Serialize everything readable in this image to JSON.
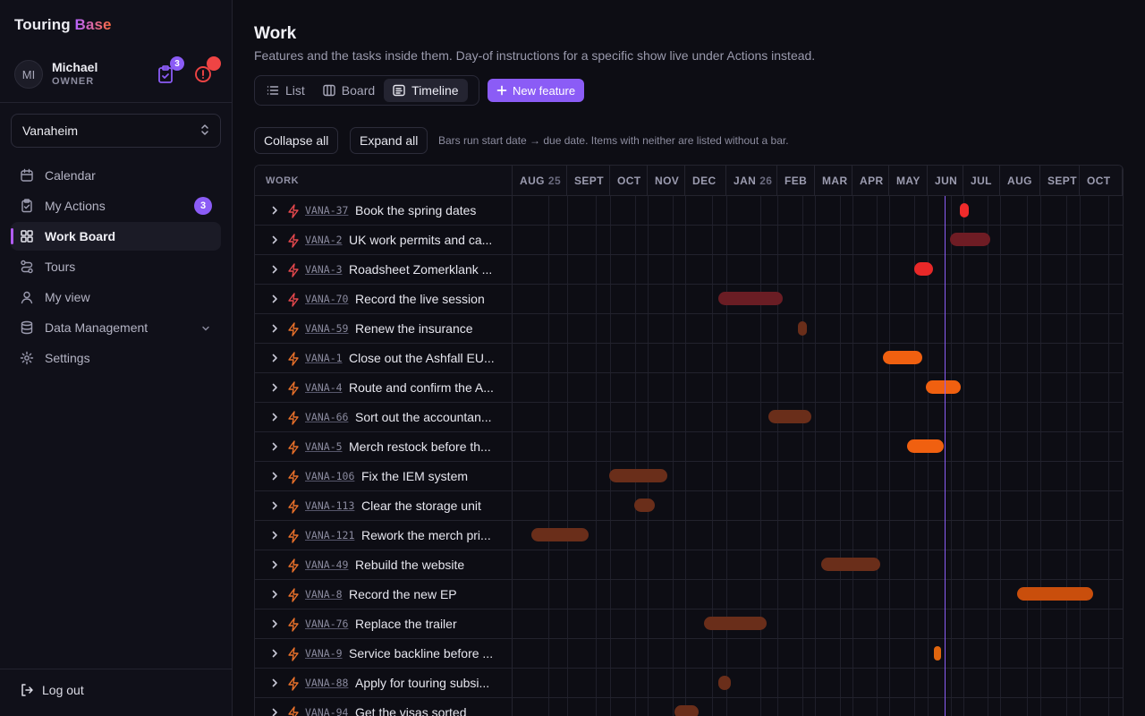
{
  "app": {
    "brand_part1": "Touring",
    "brand_part2": "Base"
  },
  "user": {
    "initials": "MI",
    "name": "Michael",
    "role": "OWNER",
    "tasks_badge": "3"
  },
  "org_select": {
    "value": "Vanaheim"
  },
  "nav": {
    "items": [
      {
        "label": "Calendar",
        "icon": "calendar-icon"
      },
      {
        "label": "My Actions",
        "icon": "clipboard-icon",
        "badge": "3"
      },
      {
        "label": "Work Board",
        "icon": "grid-icon",
        "active": true
      },
      {
        "label": "Tours",
        "icon": "route-icon"
      },
      {
        "label": "My view",
        "icon": "user-icon"
      },
      {
        "label": "Data Management",
        "icon": "database-icon",
        "expandable": true
      },
      {
        "label": "Settings",
        "icon": "gear-icon"
      }
    ],
    "logout_label": "Log out"
  },
  "page": {
    "title": "Work",
    "subtitle": "Features and the tasks inside them. Day-of instructions for a specific show live under Actions instead.",
    "views": {
      "list": "List",
      "board": "Board",
      "timeline": "Timeline",
      "active": "timeline"
    },
    "new_feature_label": "New feature",
    "collapse_all": "Collapse all",
    "expand_all": "Expand all",
    "hint": "Bars run start date → due date. Items with neither are listed without a bar."
  },
  "timeline": {
    "work_header": "WORK",
    "months": [
      {
        "label": "AUG",
        "year": "25"
      },
      {
        "label": "SEPT"
      },
      {
        "label": "OCT"
      },
      {
        "label": "NOV"
      },
      {
        "label": "DEC"
      },
      {
        "label": "JAN",
        "year": "26"
      },
      {
        "label": "FEB"
      },
      {
        "label": "MAR"
      },
      {
        "label": "APR"
      },
      {
        "label": "MAY"
      },
      {
        "label": "JUN"
      },
      {
        "label": "JUL"
      },
      {
        "label": "AUG"
      },
      {
        "label": "SEPT"
      },
      {
        "label": "OCT"
      }
    ],
    "rows": [
      {
        "key": "VANA-37",
        "title": "Book the spring dates",
        "start": "2026-07-01",
        "end": "2026-07-08",
        "color": "#ef2b2b"
      },
      {
        "key": "VANA-2",
        "title": "UK work permits and ca...",
        "start": "2026-06-24",
        "end": "2026-07-24",
        "color": "#6e1c24"
      },
      {
        "key": "VANA-3",
        "title": "Roadsheet Zomerklank ...",
        "start": "2026-05-28",
        "end": "2026-06-11",
        "color": "#e82828"
      },
      {
        "key": "VANA-70",
        "title": "Record the live session",
        "start": "2026-01-02",
        "end": "2026-02-19",
        "color": "#6a1d24"
      },
      {
        "key": "VANA-59",
        "title": "Renew the insurance",
        "start": "2026-03-02",
        "end": "2026-03-09",
        "color": "#6a2e1a"
      },
      {
        "key": "VANA-1",
        "title": "Close out the Ashfall EU...",
        "start": "2026-05-05",
        "end": "2026-06-03",
        "color": "#f06010"
      },
      {
        "key": "VANA-4",
        "title": "Route and confirm the A...",
        "start": "2026-06-06",
        "end": "2026-07-02",
        "color": "#f06010"
      },
      {
        "key": "VANA-66",
        "title": "Sort out the accountan...",
        "start": "2026-02-08",
        "end": "2026-03-12",
        "color": "#6a2e1a"
      },
      {
        "key": "VANA-5",
        "title": "Merch restock before th...",
        "start": "2026-05-23",
        "end": "2026-06-19",
        "color": "#f06010"
      },
      {
        "key": "VANA-106",
        "title": "Fix the IEM system",
        "start": "2025-10-12",
        "end": "2025-11-25",
        "color": "#6a2e1a"
      },
      {
        "key": "VANA-113",
        "title": "Clear the storage unit",
        "start": "2025-10-31",
        "end": "2025-11-15",
        "color": "#6a2e1a"
      },
      {
        "key": "VANA-121",
        "title": "Rework the merch pri...",
        "start": "2025-08-15",
        "end": "2025-09-27",
        "color": "#6a2e1a"
      },
      {
        "key": "VANA-49",
        "title": "Rebuild the website",
        "start": "2026-03-20",
        "end": "2026-05-03",
        "color": "#6a2e1a"
      },
      {
        "key": "VANA-8",
        "title": "Record the new EP",
        "start": "2026-08-13",
        "end": "2026-10-09",
        "color": "#c94e0c"
      },
      {
        "key": "VANA-76",
        "title": "Replace the trailer",
        "start": "2025-12-22",
        "end": "2026-02-07",
        "color": "#6a2e1a"
      },
      {
        "key": "VANA-9",
        "title": "Service backline before ...",
        "start": "2026-06-12",
        "end": "2026-06-15",
        "color": "#e0650e"
      },
      {
        "key": "VANA-88",
        "title": "Apply for touring subsi...",
        "start": "2026-01-02",
        "end": "2026-01-11",
        "color": "#6a2e1a"
      },
      {
        "key": "VANA-94",
        "title": "Get the visas sorted",
        "start": "2025-11-30",
        "end": "2025-12-18",
        "color": "#6a2e1a"
      }
    ]
  }
}
